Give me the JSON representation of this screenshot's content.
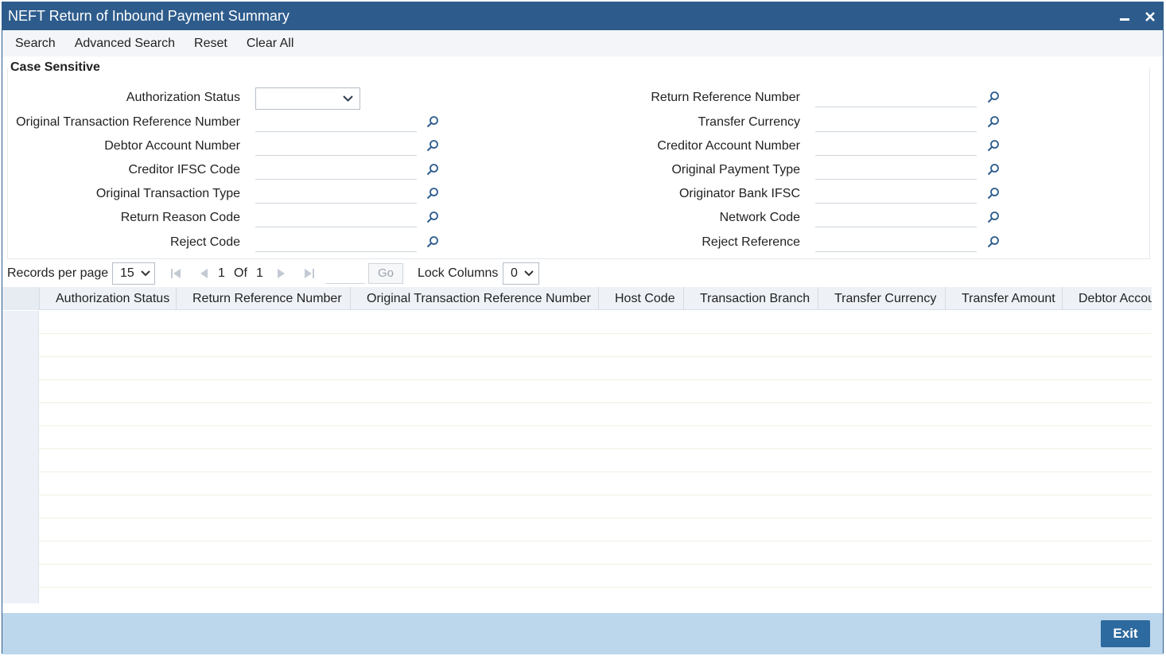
{
  "window": {
    "title": "NEFT Return of Inbound Payment Summary"
  },
  "toolbar": {
    "search": "Search",
    "advanced_search": "Advanced Search",
    "reset": "Reset",
    "clear_all": "Clear All"
  },
  "section": {
    "case_sensitive": "Case Sensitive"
  },
  "fields_left": [
    {
      "label": "Authorization Status",
      "type": "select",
      "value": ""
    },
    {
      "label": "Original Transaction Reference Number",
      "type": "lookup",
      "value": ""
    },
    {
      "label": "Debtor Account Number",
      "type": "lookup",
      "value": ""
    },
    {
      "label": "Creditor IFSC Code",
      "type": "lookup",
      "value": ""
    },
    {
      "label": "Original Transaction Type",
      "type": "lookup",
      "value": ""
    },
    {
      "label": "Return Reason Code",
      "type": "lookup",
      "value": ""
    },
    {
      "label": "Reject Code",
      "type": "lookup",
      "value": ""
    }
  ],
  "fields_right": [
    {
      "label": "Return Reference Number",
      "type": "lookup",
      "value": ""
    },
    {
      "label": "Transfer Currency",
      "type": "lookup",
      "value": ""
    },
    {
      "label": "Creditor Account Number",
      "type": "lookup",
      "value": ""
    },
    {
      "label": "Original Payment Type",
      "type": "lookup",
      "value": ""
    },
    {
      "label": "Originator Bank IFSC",
      "type": "lookup",
      "value": ""
    },
    {
      "label": "Network Code",
      "type": "lookup",
      "value": ""
    },
    {
      "label": "Reject Reference",
      "type": "lookup",
      "value": ""
    }
  ],
  "pager": {
    "records_per_page_label": "Records per page",
    "records_per_page": "15",
    "current_page": "1",
    "of_label": "Of",
    "total_pages": "1",
    "go_label": "Go",
    "lock_columns_label": "Lock Columns",
    "lock_columns": "0"
  },
  "grid": {
    "columns": [
      "Authorization Status",
      "Return Reference Number",
      "Original Transaction Reference Number",
      "Host Code",
      "Transaction Branch",
      "Transfer Currency",
      "Transfer Amount",
      "Debtor Accou"
    ],
    "empty_rows": 13
  },
  "footer": {
    "exit": "Exit"
  },
  "colors": {
    "title_bar": "#2d5c8c",
    "footer": "#bcd6ec",
    "exit_button": "#2d6a9f"
  }
}
